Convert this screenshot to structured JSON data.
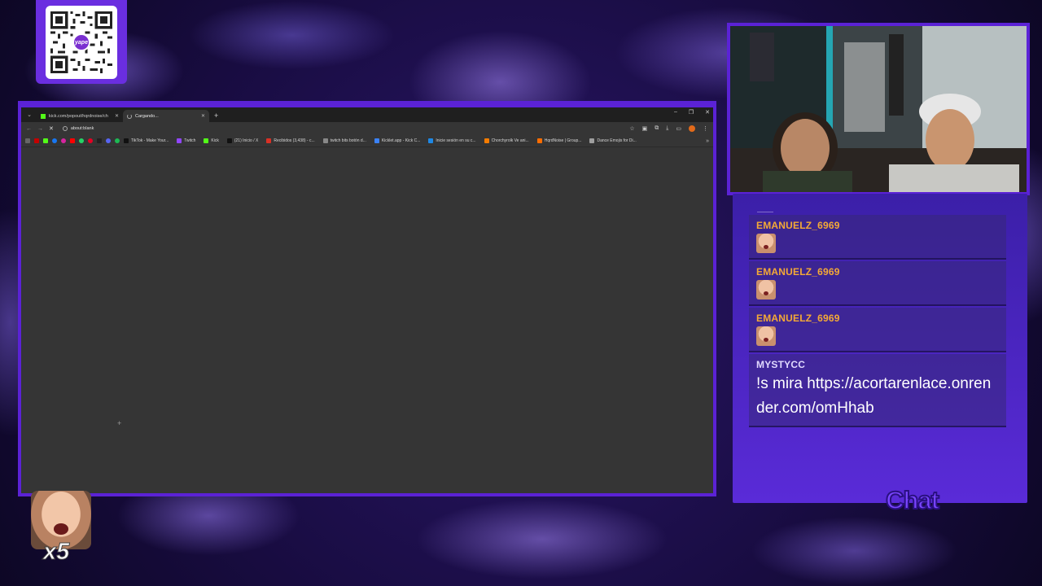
{
  "qr": {
    "logo_text": "yape"
  },
  "browser": {
    "tabs": [
      {
        "title": "kick.com/popout/hqrdnoise/ch",
        "active": false
      },
      {
        "title": "Cargando...",
        "active": true
      }
    ],
    "url": "about:blank",
    "bookmarks": [
      {
        "label": "TikTok - Make Your...",
        "color": "#111111"
      },
      {
        "label": "Twitch",
        "color": "#9146ff"
      },
      {
        "label": "Kick",
        "color": "#53fc18"
      },
      {
        "label": "(21) Inicio / X",
        "color": "#111111"
      },
      {
        "label": "Recibidos (3,438) - c...",
        "color": "#d93025"
      },
      {
        "label": "twitch bits botón d...",
        "color": "#888888"
      },
      {
        "label": "Kicklet.app - Kick C...",
        "color": "#3b82f6"
      },
      {
        "label": "Inicie sesión en su c...",
        "color": "#1e88e5"
      },
      {
        "label": "Chorchyrolk Ve ani...",
        "color": "#f57c00"
      },
      {
        "label": "HqrdNoise | Group...",
        "color": "#ff6d00"
      },
      {
        "label": "Dance Emojis for Di...",
        "color": "#9e9e9e"
      }
    ]
  },
  "chat": {
    "title": "Chat",
    "messages": [
      {
        "user": "EMANUELZ_6969",
        "emote": "face-emote",
        "text": ""
      },
      {
        "user": "EMANUELZ_6969",
        "emote": "face-emote",
        "text": ""
      },
      {
        "user": "EMANUELZ_6969",
        "emote": "face-emote",
        "text": ""
      },
      {
        "user": "MYSTYCC",
        "emote": "",
        "text": "!s mira https://acortarenlace.onrender.com/omHhab"
      }
    ]
  },
  "emote_counter": {
    "multiplier": "x5"
  },
  "colors": {
    "frame_purple": "#5b22d6",
    "username_orange": "#f4a936",
    "kick_green": "#53fc18"
  }
}
